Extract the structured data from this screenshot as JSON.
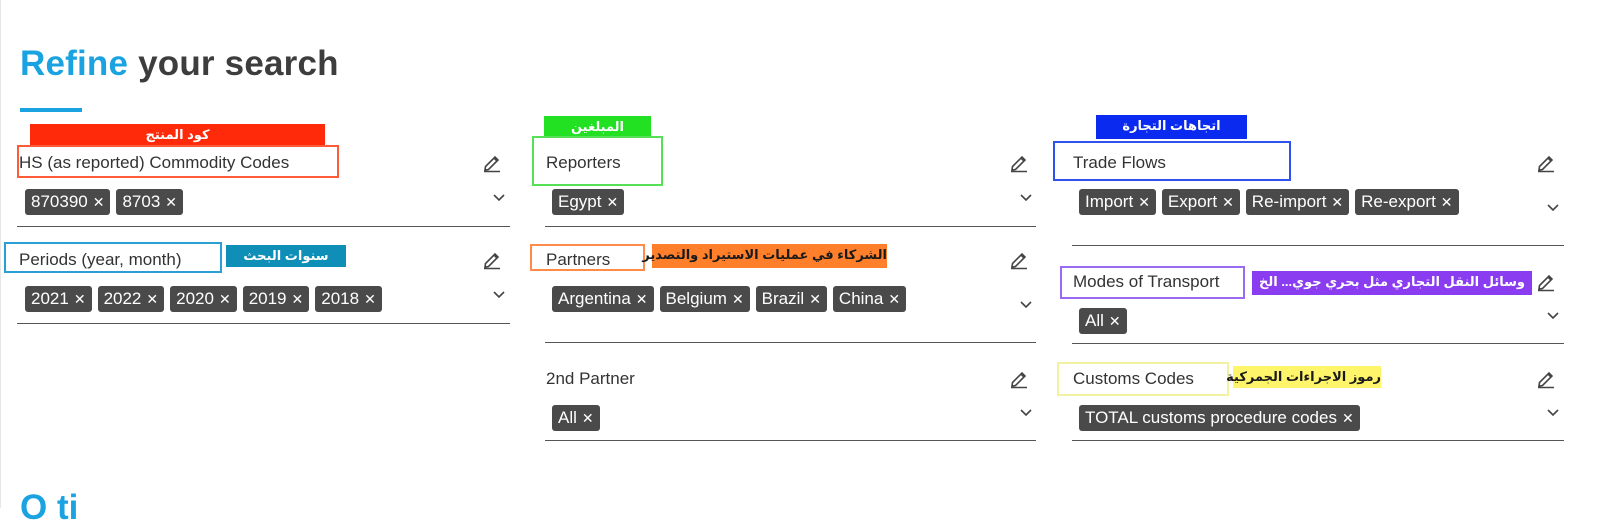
{
  "heading": {
    "accent": "Refine",
    "rest": " your search"
  },
  "bottom_peek": "O           ti",
  "fields": {
    "commodity": {
      "label": "HS (as reported) Commodity Codes",
      "chips": [
        "870390",
        "8703"
      ]
    },
    "periods": {
      "label": "Periods (year, month)",
      "chips": [
        "2021",
        "2022",
        "2020",
        "2019",
        "2018"
      ]
    },
    "reporters": {
      "label": "Reporters",
      "chips": [
        "Egypt"
      ]
    },
    "partners": {
      "label": "Partners",
      "chips": [
        "Argentina",
        "Belgium",
        "Brazil",
        "China"
      ]
    },
    "second_partner": {
      "label": "2nd Partner",
      "chips": [
        "All"
      ]
    },
    "trade_flows": {
      "label": "Trade Flows",
      "chips": [
        "Import",
        "Export",
        "Re-import",
        "Re-export"
      ]
    },
    "transport": {
      "label": "Modes of Transport",
      "chips": [
        "All"
      ]
    },
    "customs": {
      "label": "Customs Codes",
      "chips": [
        "TOTAL customs procedure codes"
      ]
    }
  },
  "annotations": {
    "commodity": {
      "text": "كود المنتج",
      "bg": "#ff2a0a",
      "color": "#ffffff"
    },
    "periods": {
      "text": "سنوات البحث",
      "bg": "#0f8fb8",
      "color": "#ffffff"
    },
    "reporters": {
      "text": "المبلغين",
      "bg": "#22e022",
      "color": "#ffffff"
    },
    "partners": {
      "text": "الشركاء في عمليات الاستيراد والتصدير",
      "bg": "#ff7f2a",
      "color": "#1a1a1a"
    },
    "trade_flows": {
      "text": "اتجاهات التجارة",
      "bg": "#0a2af0",
      "color": "#ffffff"
    },
    "transport": {
      "text": "وسائل النقل التجاري مثل بحري جوي... الخ",
      "bg": "#8a3cf0",
      "color": "#ffffff"
    },
    "customs": {
      "text": "رموز الاجراءات الجمركية",
      "bg": "#fff56a",
      "color": "#1a1a1a"
    }
  },
  "icons": {
    "edit": "pencil-icon",
    "expand": "chevron-down-icon",
    "remove": "close-icon"
  },
  "colors": {
    "accent": "#1aa3e0",
    "chip": "#4a4a4a"
  }
}
